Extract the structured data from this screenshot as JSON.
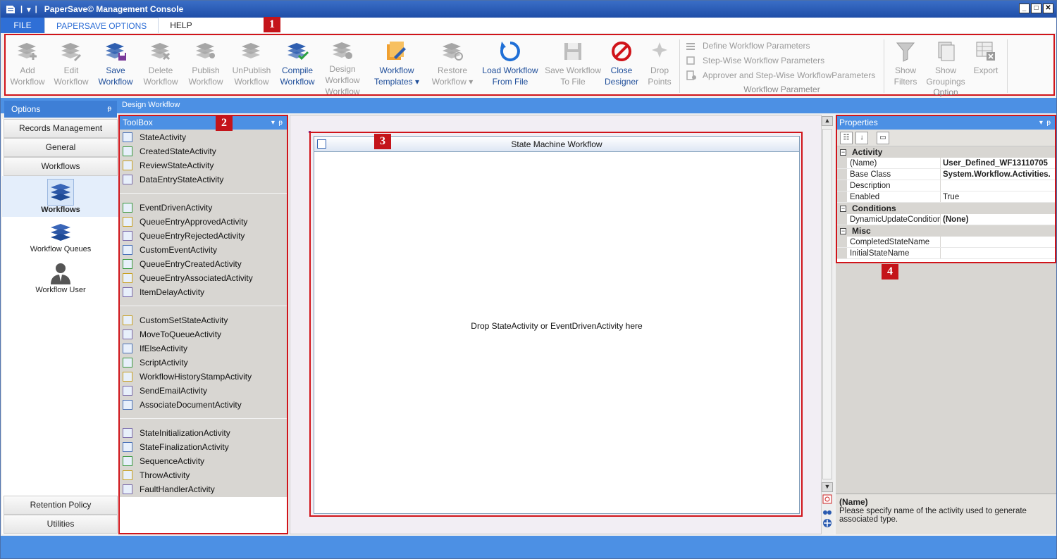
{
  "window": {
    "title": "PaperSave© Management Console"
  },
  "menu": {
    "file": "FILE",
    "options": "PAPERSAVE OPTIONS",
    "help": "HELP"
  },
  "badges": [
    "1",
    "2",
    "3",
    "4"
  ],
  "ribbon": {
    "buttons": [
      {
        "l1": "Add",
        "l2": "Workflow",
        "l3": "",
        "icon": "add-workflow-icon",
        "enabled": false
      },
      {
        "l1": "Edit",
        "l2": "Workflow",
        "l3": "",
        "icon": "edit-workflow-icon",
        "enabled": false
      },
      {
        "l1": "Save",
        "l2": "Workflow",
        "l3": "",
        "icon": "save-workflow-icon",
        "enabled": true
      },
      {
        "l1": "Delete",
        "l2": "Workflow",
        "l3": "",
        "icon": "delete-workflow-icon",
        "enabled": false
      },
      {
        "l1": "Publish",
        "l2": "Workflow",
        "l3": "",
        "icon": "publish-workflow-icon",
        "enabled": false
      },
      {
        "l1": "UnPublish",
        "l2": "Workflow",
        "l3": "",
        "icon": "unpublish-workflow-icon",
        "enabled": false
      },
      {
        "l1": "Compile",
        "l2": "Workflow",
        "l3": "",
        "icon": "compile-workflow-icon",
        "enabled": true
      },
      {
        "l1": "Design",
        "l2": "Workflow",
        "l3": "Workflow",
        "icon": "design-workflow-icon",
        "enabled": false
      },
      {
        "l1": "Workflow",
        "l2": "Templates ▾",
        "l3": "",
        "icon": "workflow-templates-icon",
        "enabled": true
      },
      {
        "l1": "Restore",
        "l2": "Workflow ▾",
        "l3": "",
        "icon": "restore-workflow-icon",
        "enabled": false
      },
      {
        "l1": "Load Workflow",
        "l2": "From File",
        "l3": "",
        "icon": "load-workflow-icon",
        "enabled": true
      },
      {
        "l1": "Save Workflow",
        "l2": "To File",
        "l3": "",
        "icon": "save-to-file-icon",
        "enabled": false
      },
      {
        "l1": "Close",
        "l2": "Designer",
        "l3": "",
        "icon": "close-designer-icon",
        "enabled": true
      },
      {
        "l1": "Drop",
        "l2": "Points",
        "l3": "",
        "icon": "drop-points-icon",
        "enabled": false
      }
    ],
    "wfparams": {
      "items": [
        "Define Workflow Parameters",
        "Step-Wise Workflow Parameters",
        "Approver and Step-Wise WorkflowParameters"
      ],
      "group": "Workflow Parameter"
    },
    "option": {
      "buttons": [
        {
          "l1": "Show",
          "l2": "Filters"
        },
        {
          "l1": "Show",
          "l2": "Groupings"
        },
        {
          "l1": "Export",
          "l2": ""
        }
      ],
      "group": "Option"
    }
  },
  "strip": {
    "label": "Design Workflow"
  },
  "options": {
    "title": "Options",
    "pin": "ᵽ"
  },
  "nav": {
    "top": [
      "Records Management",
      "General",
      "Workflows"
    ],
    "items": [
      {
        "label": "Workflows",
        "icon": "workflows-icon"
      },
      {
        "label": "Workflow Queues",
        "icon": "workflow-queues-icon"
      },
      {
        "label": "Workflow User",
        "icon": "workflow-user-icon"
      }
    ],
    "bottom": [
      "Retention Policy",
      "Utilities"
    ]
  },
  "toolbox": {
    "title": "ToolBox",
    "groups": [
      [
        "StateActivity",
        "CreatedStateActivity",
        "ReviewStateActivity",
        "DataEntryStateActivity"
      ],
      [
        "EventDrivenActivity",
        "QueueEntryApprovedActivity",
        "QueueEntryRejectedActivity",
        "CustomEventActivity",
        "QueueEntryCreatedActivity",
        "QueueEntryAssociatedActivity",
        "ItemDelayActivity"
      ],
      [
        "CustomSetStateActivity",
        "MoveToQueueActivity",
        "IfElseActivity",
        "ScriptActivity",
        "WorkflowHistoryStampActivity",
        "SendEmailActivity",
        "AssociateDocumentActivity"
      ],
      [
        "StateInitializationActivity",
        "StateFinalizationActivity",
        "SequenceActivity",
        "ThrowActivity",
        "FaultHandlerActivity"
      ]
    ]
  },
  "designer": {
    "title": "State Machine Workflow",
    "drop": "Drop StateActivity or EventDrivenActivity here"
  },
  "properties": {
    "title": "Properties",
    "categories": [
      {
        "name": "Activity",
        "rows": [
          {
            "k": "(Name)",
            "v": "User_Defined_WF13110705",
            "bold": true
          },
          {
            "k": "Base Class",
            "v": "System.Workflow.Activities.",
            "bold": true
          },
          {
            "k": "Description",
            "v": "",
            "bold": false
          },
          {
            "k": "Enabled",
            "v": "True",
            "bold": false
          }
        ]
      },
      {
        "name": "Conditions",
        "rows": [
          {
            "k": "DynamicUpdateCondition",
            "v": "(None)",
            "bold": true
          }
        ]
      },
      {
        "name": "Misc",
        "rows": [
          {
            "k": "CompletedStateName",
            "v": "",
            "bold": false
          },
          {
            "k": "InitialStateName",
            "v": "",
            "bold": false
          }
        ]
      }
    ],
    "desc_title": "(Name)",
    "desc_text": "Please specify name of the activity used to generate associated type."
  }
}
